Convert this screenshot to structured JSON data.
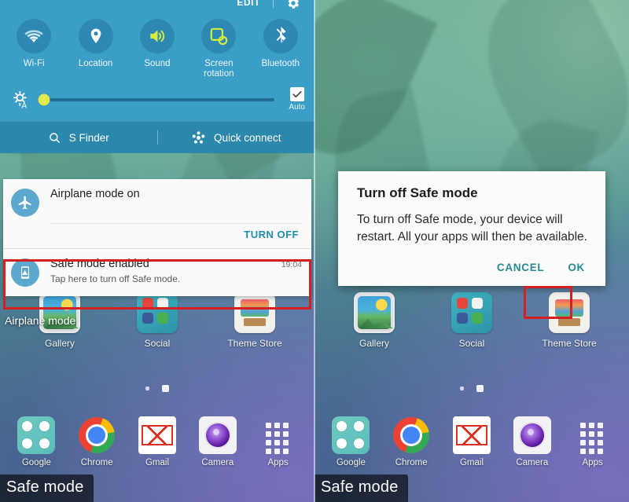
{
  "quick_settings": {
    "edit_label": "EDIT",
    "gear_icon": "gear-icon",
    "toggles": [
      {
        "label": "Wi-Fi",
        "icon": "wifi-icon",
        "active": false
      },
      {
        "label": "Location",
        "icon": "location-pin-icon",
        "active": false
      },
      {
        "label": "Sound",
        "icon": "sound-speaker-icon",
        "active": true
      },
      {
        "label": "Screen\nrotation",
        "icon": "screen-rotation-icon",
        "active": true
      },
      {
        "label": "Bluetooth",
        "icon": "bluetooth-icon",
        "active": false
      }
    ],
    "toggle_labels": {
      "wifi": "Wi-Fi",
      "location": "Location",
      "sound": "Sound",
      "screen_rotation_line1": "Screen",
      "screen_rotation_line2": "rotation",
      "bluetooth": "Bluetooth"
    },
    "brightness": {
      "icon": "brightness-auto-icon",
      "value_percent": 2,
      "auto_label": "Auto",
      "auto_checked": true
    },
    "search_row": {
      "s_finder_label": "S Finder",
      "s_finder_icon": "search-icon",
      "quick_connect_label": "Quick connect",
      "quick_connect_icon": "quick-connect-icon"
    },
    "colors": {
      "panel_bg": "#3b9ec6",
      "circle_bg": "#2d89b3",
      "search_bar_bg": "#2b87ab",
      "active_icon": "#d6ec3e",
      "slider_thumb": "#e3ea4f",
      "slider_track": "#1e6f93"
    }
  },
  "notifications": [
    {
      "icon": "airplane-icon",
      "title": "Airplane mode on",
      "subtitle": "",
      "time": "",
      "action_label": "TURN OFF",
      "highlighted": false
    },
    {
      "icon": "safe-mode-device-icon",
      "title": "Safe mode enabled",
      "subtitle": "Tap here to turn off Safe mode.",
      "time": "19:04",
      "action_label": "",
      "highlighted": true
    }
  ],
  "dialog": {
    "title": "Turn off Safe mode",
    "message": "To turn off Safe mode, your device will restart. All your apps will then be available.",
    "cancel_label": "CANCEL",
    "ok_label": "OK",
    "ok_highlighted": true,
    "accent_color": "#2a8a94"
  },
  "homescreen": {
    "apps": [
      {
        "label": "Gallery",
        "icon": "gallery-icon"
      },
      {
        "label": "Social",
        "icon": "social-folder-icon"
      },
      {
        "label": "Theme Store",
        "icon": "theme-store-icon"
      }
    ],
    "page_dots": {
      "count": 2,
      "active_index": 1
    },
    "dock": [
      {
        "label": "Google",
        "icon": "google-folder-icon"
      },
      {
        "label": "Chrome",
        "icon": "chrome-icon"
      },
      {
        "label": "Gmail",
        "icon": "gmail-icon"
      },
      {
        "label": "Camera",
        "icon": "camera-icon"
      },
      {
        "label": "Apps",
        "icon": "apps-grid-icon"
      }
    ],
    "safe_mode_badge": "Safe mode",
    "airplane_toast": "Airplane mode"
  },
  "annotation": {
    "highlight_color": "#d42020"
  }
}
